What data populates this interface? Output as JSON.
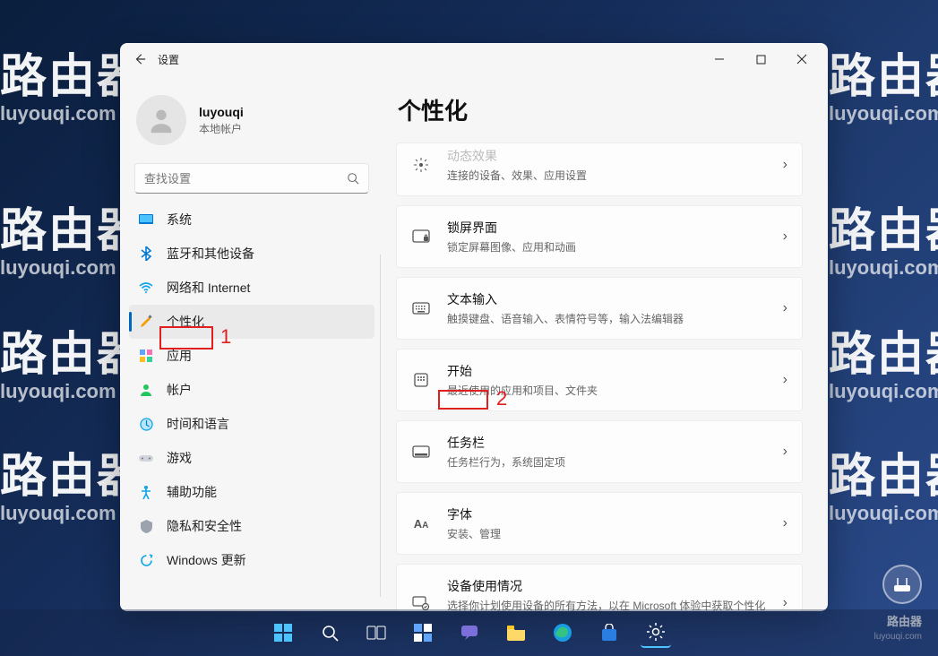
{
  "watermark": {
    "big": "路由器",
    "small": "luyouqi.com"
  },
  "window": {
    "back_icon": "back-arrow",
    "title": "设置",
    "controls": {
      "min": "—",
      "max": "▢",
      "close": "✕"
    }
  },
  "profile": {
    "name": "luyouqi",
    "sub": "本地帐户"
  },
  "search": {
    "placeholder": "查找设置"
  },
  "sidebar": {
    "items": [
      {
        "icon": "system",
        "label": "系统"
      },
      {
        "icon": "bluetooth",
        "label": "蓝牙和其他设备"
      },
      {
        "icon": "network",
        "label": "网络和 Internet"
      },
      {
        "icon": "personalize",
        "label": "个性化"
      },
      {
        "icon": "apps",
        "label": "应用"
      },
      {
        "icon": "accounts",
        "label": "帐户"
      },
      {
        "icon": "time",
        "label": "时间和语言"
      },
      {
        "icon": "gaming",
        "label": "游戏"
      },
      {
        "icon": "accessibility",
        "label": "辅助功能"
      },
      {
        "icon": "privacy",
        "label": "隐私和安全性"
      },
      {
        "icon": "update",
        "label": "Windows 更新"
      }
    ],
    "active_index": 3
  },
  "page": {
    "title": "个性化",
    "cards": [
      {
        "icon": "sparkle",
        "title": "动态效果",
        "sub": "连接的设备、效果、应用设置",
        "truncated_top": true
      },
      {
        "icon": "lock",
        "title": "锁屏界面",
        "sub": "锁定屏幕图像、应用和动画"
      },
      {
        "icon": "keyboard",
        "title": "文本输入",
        "sub": "触摸键盘、语音输入、表情符号等，输入法编辑器"
      },
      {
        "icon": "start",
        "title": "开始",
        "sub": "最近使用的应用和项目、文件夹"
      },
      {
        "icon": "taskbar",
        "title": "任务栏",
        "sub": "任务栏行为，系统固定项"
      },
      {
        "icon": "fonts",
        "title": "字体",
        "sub": "安装、管理"
      },
      {
        "icon": "usage",
        "title": "设备使用情况",
        "sub": "选择你计划使用设备的所有方法，以在 Microsoft 体验中获取个性化的提示、广告和建议。"
      }
    ]
  },
  "annotations": {
    "one": "1",
    "two": "2"
  },
  "float_label": "路由器",
  "float_sub": "luyouqi.com"
}
